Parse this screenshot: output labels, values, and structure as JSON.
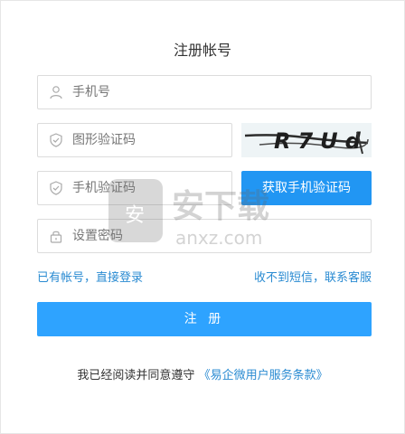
{
  "form": {
    "title": "注册帐号",
    "phone_placeholder": "手机号",
    "captcha_placeholder": "图形验证码",
    "captcha_image_text": "R7Ud",
    "sms_code_placeholder": "手机验证码",
    "sms_button_label": "获取手机验证码",
    "password_placeholder": "设置密码",
    "login_link": "已有帐号，直接登录",
    "support_link": "收不到短信，联系客服",
    "register_button": "注 册",
    "agree_prefix": "我已经阅读并同意遵守",
    "terms_link": "《易企微用户服务条款》"
  },
  "watermark": {
    "text_main": "安下载",
    "text_sub": "anxz.com"
  },
  "colors": {
    "primary": "#2196f3",
    "register": "#2ea3ff",
    "link": "#2a8bd2"
  }
}
